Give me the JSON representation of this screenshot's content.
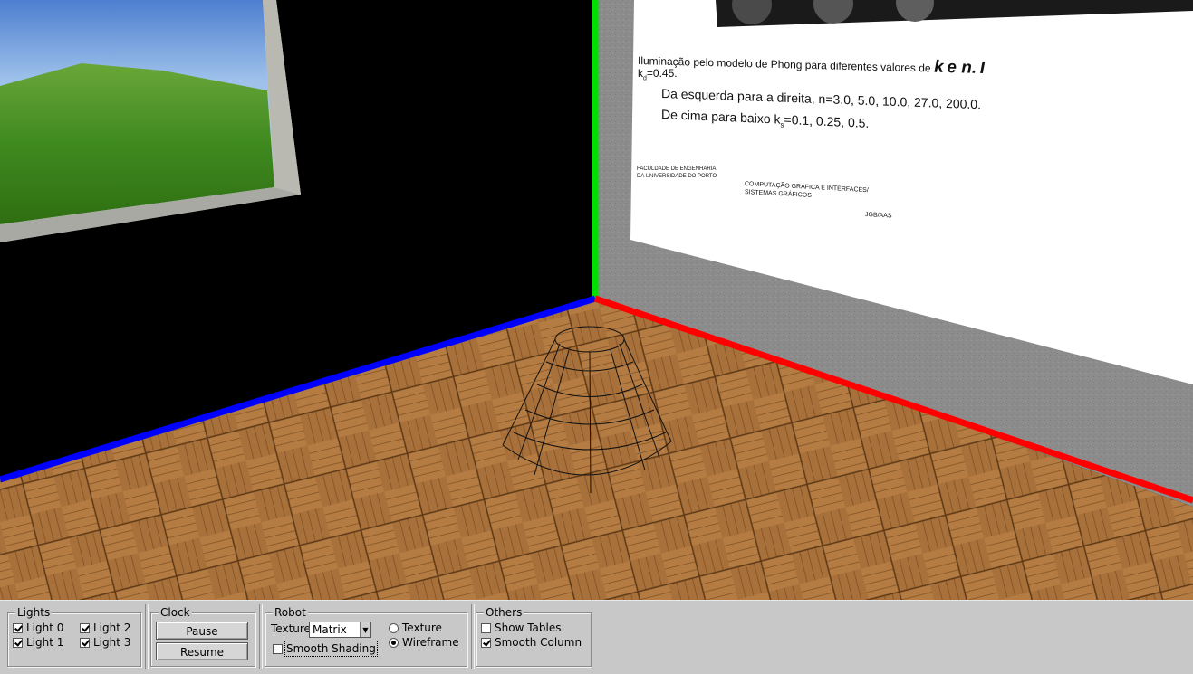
{
  "poster": {
    "caption_line1": "Iluminação pelo modelo de Phong para diferentes valores de",
    "caption_line1_tail": "k",
    "caption_line1_e": "e n.",
    "caption_line1_I": "I",
    "kd_line": "=0.45.",
    "line2": "Da esquerda para a direita, n=3.0, 5.0, 10.0, 27.0, 200.0.",
    "line3_prefix": "De cima para baixo k",
    "line3_values": "=0.1, 0.25, 0.5.",
    "footer_left_1": "FACULDADE DE ENGENHARIA",
    "footer_left_2": "DA UNIVERSIDADE DO PORTO",
    "footer_mid_1": "COMPUTAÇÃO GRÁFICA E INTERFACES/",
    "footer_mid_2": "SISTEMAS GRÁFICOS",
    "footer_right": "JGB/AAS"
  },
  "scene": {
    "axis_colors": {
      "x": "#ff0000",
      "y": "#00e000",
      "z": "#0000ff"
    },
    "floor_color": "#a8703a",
    "wall_right_color": "#8a8a8a",
    "wall_left_color": "#000000"
  },
  "panel": {
    "lights": {
      "title": "Lights",
      "items": [
        {
          "label": "Light 0",
          "checked": true
        },
        {
          "label": "Light 1",
          "checked": true
        },
        {
          "label": "Light 2",
          "checked": true
        },
        {
          "label": "Light 3",
          "checked": true
        }
      ]
    },
    "clock": {
      "title": "Clock",
      "pause_label": "Pause",
      "resume_label": "Resume"
    },
    "robot": {
      "title": "Robot",
      "texture_label": "Texture",
      "texture_value": "Matrix",
      "smooth_shading_label": "Smooth Shading",
      "smooth_shading_checked": false,
      "radio_texture_label": "Texture",
      "radio_wireframe_label": "Wireframe",
      "selected_mode": "Wireframe"
    },
    "others": {
      "title": "Others",
      "show_tables_label": "Show Tables",
      "show_tables_checked": false,
      "smooth_column_label": "Smooth Column",
      "smooth_column_checked": true
    }
  }
}
